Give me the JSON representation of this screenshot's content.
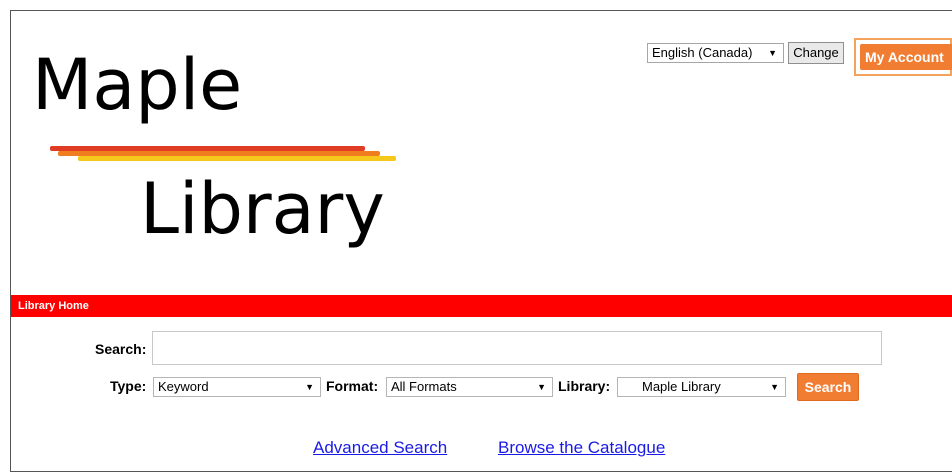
{
  "logo": {
    "line1": "Maple",
    "line2": "Library",
    "stripe_colors": [
      "#e03c23",
      "#f07d1e",
      "#f6c81c"
    ]
  },
  "header": {
    "language_selected": "English (Canada)",
    "change_label": "Change",
    "my_account_label": "My Account"
  },
  "navbar": {
    "home_label": "Library Home",
    "color": "#ff0000"
  },
  "search": {
    "search_label": "Search:",
    "search_value": "",
    "type_label": "Type:",
    "type_value": "Keyword",
    "format_label": "Format:",
    "format_value": "All Formats",
    "library_label": "Library:",
    "library_value": "Maple Library",
    "search_button": "Search",
    "button_color": "#f07d32"
  },
  "links": {
    "advanced": "Advanced Search",
    "browse": "Browse the Catalogue"
  }
}
